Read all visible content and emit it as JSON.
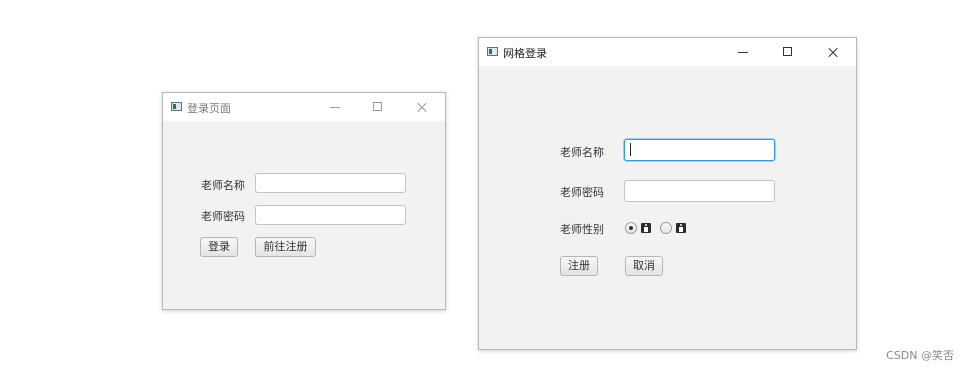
{
  "login_window": {
    "title": "登录页面",
    "name_label": "老师名称",
    "name_value": "",
    "password_label": "老师密码",
    "password_value": "",
    "login_button": "登录",
    "register_button": "前往注册"
  },
  "grid_window": {
    "title": "网格登录",
    "name_label": "老师名称",
    "name_value": "",
    "password_label": "老师密码",
    "password_value": "",
    "gender_label": "老师性别",
    "gender_options": [
      {
        "icon": "male-person-icon",
        "checked": true
      },
      {
        "icon": "female-person-icon",
        "checked": false
      }
    ],
    "register_button": "注册",
    "cancel_button": "取消"
  },
  "watermark": "CSDN @笑否",
  "colors": {
    "window_bg": "#f2f2f2",
    "titlebar_bg": "#ffffff",
    "focus_border": "#3a9ad9"
  }
}
